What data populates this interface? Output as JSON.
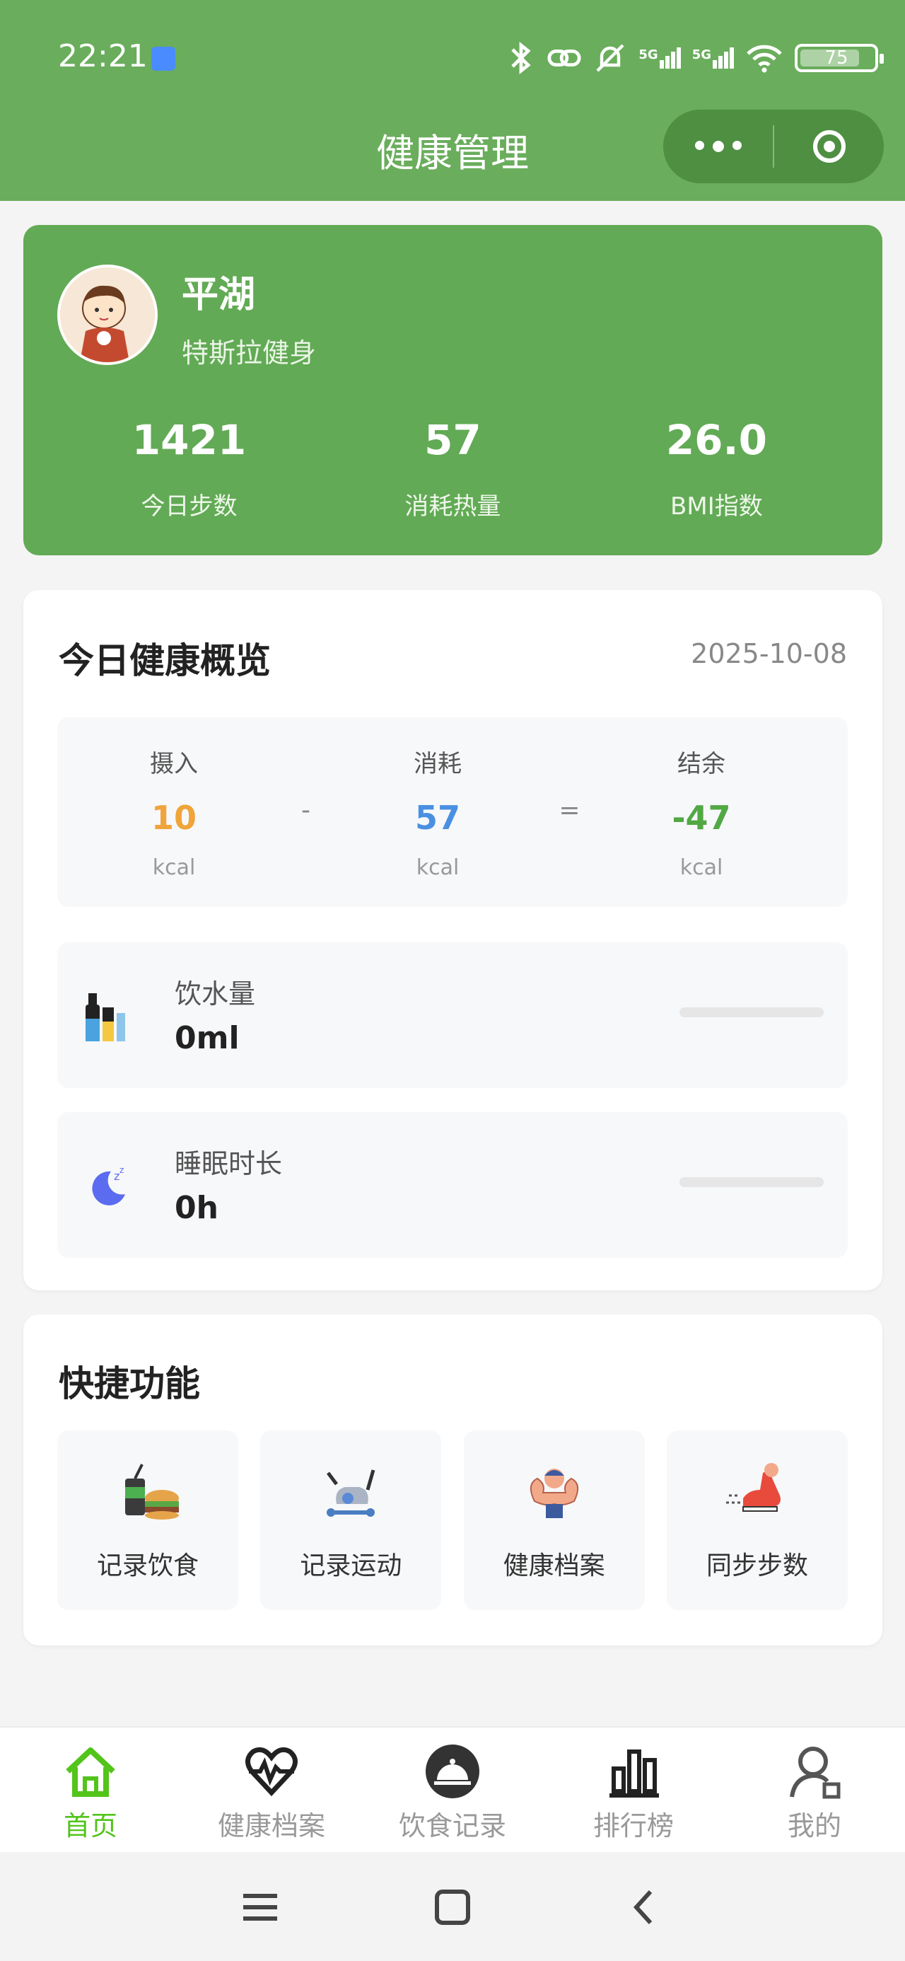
{
  "status_bar": {
    "time": "22:21",
    "network_labels": [
      "5G",
      "5G"
    ],
    "battery": "75"
  },
  "nav": {
    "title": "健康管理"
  },
  "profile": {
    "name": "平湖",
    "group": "特斯拉健身",
    "stats": [
      {
        "value": "1421",
        "label": "今日步数"
      },
      {
        "value": "57",
        "label": "消耗热量"
      },
      {
        "value": "26.0",
        "label": "BMI指数"
      }
    ]
  },
  "overview": {
    "title": "今日健康概览",
    "date": "2025-10-08",
    "energy": {
      "intake": {
        "label": "摄入",
        "value": "10",
        "unit": "kcal"
      },
      "op_minus": "-",
      "burn": {
        "label": "消耗",
        "value": "57",
        "unit": "kcal"
      },
      "op_equal": "=",
      "balance": {
        "label": "结余",
        "value": "-47",
        "unit": "kcal"
      }
    },
    "water": {
      "label": "饮水量",
      "value": "0ml",
      "progress": 0
    },
    "sleep": {
      "label": "睡眠时长",
      "value": "0h",
      "progress": 0
    }
  },
  "quick": {
    "title": "快捷功能",
    "items": [
      {
        "label": "记录饮食",
        "icon": "food-icon"
      },
      {
        "label": "记录运动",
        "icon": "exercise-bike-icon"
      },
      {
        "label": "健康档案",
        "icon": "muscle-icon"
      },
      {
        "label": "同步步数",
        "icon": "running-shoe-icon"
      }
    ]
  },
  "tabbar": {
    "items": [
      {
        "label": "首页",
        "icon": "home-icon",
        "active": true
      },
      {
        "label": "健康档案",
        "icon": "heart-pulse-icon",
        "active": false
      },
      {
        "label": "饮食记录",
        "icon": "food-cloche-icon",
        "active": false
      },
      {
        "label": "排行榜",
        "icon": "bar-chart-icon",
        "active": false
      },
      {
        "label": "我的",
        "icon": "user-icon",
        "active": false
      }
    ]
  },
  "colors": {
    "brand_green": "#6aad5c",
    "intake": "#f0a43a",
    "burn": "#4a90e2",
    "balance": "#52a844",
    "tab_active": "#52c41a"
  }
}
